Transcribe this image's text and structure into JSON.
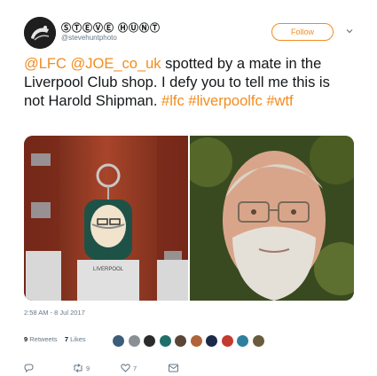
{
  "user": {
    "display_name": "ⓈⓉⒺⓋⒺ ⒽⓊⓃⓉ",
    "handle": "@stevehuntphoto"
  },
  "follow_label": "Follow",
  "tweet": {
    "parts": [
      {
        "text": "@LFC",
        "link": true
      },
      {
        "text": " ",
        "link": false
      },
      {
        "text": "@JOE_co_uk",
        "link": true
      },
      {
        "text": " spotted by a mate in the Liverpool Club shop. I defy you to tell me this is not Harold Shipman. ",
        "link": false
      },
      {
        "text": "#lfc",
        "link": true
      },
      {
        "text": " ",
        "link": false
      },
      {
        "text": "#liverpoolfc",
        "link": true
      },
      {
        "text": " ",
        "link": false
      },
      {
        "text": "#wtf",
        "link": true
      }
    ]
  },
  "timestamp": "2:58 AM - 8 Jul 2017",
  "stats": {
    "retweets_count": "9",
    "retweets_label": "Retweets",
    "likes_count": "7",
    "likes_label": "Likes"
  },
  "likers": [
    "#3b5d7a",
    "#8a8f96",
    "#2b2b2b",
    "#1f6f6a",
    "#5a4636",
    "#b0643a",
    "#1c2a4a",
    "#c43a2f",
    "#2e7f9e",
    "#6b5b3e"
  ],
  "actions": {
    "reply_count": "",
    "retweet_count": "9",
    "like_count": "7"
  },
  "colors": {
    "accent": "#f28c1f",
    "muted": "#657786"
  },
  "icons": [
    "reply-icon",
    "retweet-icon",
    "like-icon",
    "dm-icon",
    "chevron-down-icon"
  ]
}
